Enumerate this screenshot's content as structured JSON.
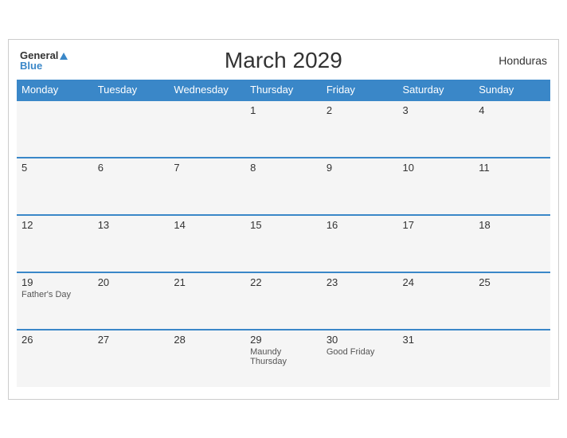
{
  "header": {
    "logo_general": "General",
    "logo_blue": "Blue",
    "title": "March 2029",
    "country": "Honduras"
  },
  "weekdays": [
    "Monday",
    "Tuesday",
    "Wednesday",
    "Thursday",
    "Friday",
    "Saturday",
    "Sunday"
  ],
  "weeks": [
    [
      {
        "day": "",
        "holiday": ""
      },
      {
        "day": "",
        "holiday": ""
      },
      {
        "day": "",
        "holiday": ""
      },
      {
        "day": "1",
        "holiday": ""
      },
      {
        "day": "2",
        "holiday": ""
      },
      {
        "day": "3",
        "holiday": ""
      },
      {
        "day": "4",
        "holiday": ""
      }
    ],
    [
      {
        "day": "5",
        "holiday": ""
      },
      {
        "day": "6",
        "holiday": ""
      },
      {
        "day": "7",
        "holiday": ""
      },
      {
        "day": "8",
        "holiday": ""
      },
      {
        "day": "9",
        "holiday": ""
      },
      {
        "day": "10",
        "holiday": ""
      },
      {
        "day": "11",
        "holiday": ""
      }
    ],
    [
      {
        "day": "12",
        "holiday": ""
      },
      {
        "day": "13",
        "holiday": ""
      },
      {
        "day": "14",
        "holiday": ""
      },
      {
        "day": "15",
        "holiday": ""
      },
      {
        "day": "16",
        "holiday": ""
      },
      {
        "day": "17",
        "holiday": ""
      },
      {
        "day": "18",
        "holiday": ""
      }
    ],
    [
      {
        "day": "19",
        "holiday": "Father's Day"
      },
      {
        "day": "20",
        "holiday": ""
      },
      {
        "day": "21",
        "holiday": ""
      },
      {
        "day": "22",
        "holiday": ""
      },
      {
        "day": "23",
        "holiday": ""
      },
      {
        "day": "24",
        "holiday": ""
      },
      {
        "day": "25",
        "holiday": ""
      }
    ],
    [
      {
        "day": "26",
        "holiday": ""
      },
      {
        "day": "27",
        "holiday": ""
      },
      {
        "day": "28",
        "holiday": ""
      },
      {
        "day": "29",
        "holiday": "Maundy Thursday"
      },
      {
        "day": "30",
        "holiday": "Good Friday"
      },
      {
        "day": "31",
        "holiday": ""
      },
      {
        "day": "",
        "holiday": ""
      }
    ]
  ]
}
